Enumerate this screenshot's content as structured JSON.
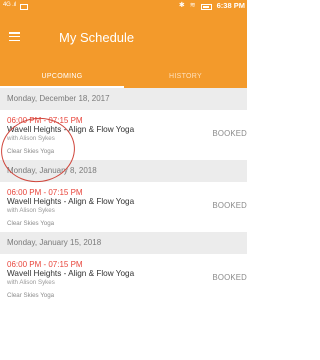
{
  "status_bar": {
    "network": "4G",
    "signal": ".ıl",
    "time": "6:38 PM"
  },
  "header": {
    "title": "My Schedule"
  },
  "tabs": [
    {
      "label": "UPCOMING",
      "active": true
    },
    {
      "label": "HISTORY",
      "active": false
    }
  ],
  "sections": [
    {
      "date": "Monday, December 18, 2017",
      "booking": {
        "time": "06:00 PM - 07:15 PM",
        "class": "Wavell Heights - Align & Flow Yoga",
        "instructor": "with Alison Sykes",
        "studio": "Clear Skies Yoga",
        "status": "BOOKED"
      }
    },
    {
      "date": "Monday, January 8, 2018",
      "booking": {
        "time": "06:00 PM - 07:15 PM",
        "class": "Wavell Heights - Align & Flow Yoga",
        "instructor": "with Alison Sykes",
        "studio": "Clear Skies Yoga",
        "status": "BOOKED"
      }
    },
    {
      "date": "Monday, January 15, 2018",
      "booking": {
        "time": "06:00 PM - 07:15 PM",
        "class": "Wavell Heights - Align & Flow Yoga",
        "instructor": "with Alison Sykes",
        "studio": "Clear Skies Yoga",
        "status": "BOOKED"
      }
    }
  ],
  "colors": {
    "primary": "#f39a2b",
    "time_text": "#e8453b",
    "section_bg": "#ececec"
  }
}
